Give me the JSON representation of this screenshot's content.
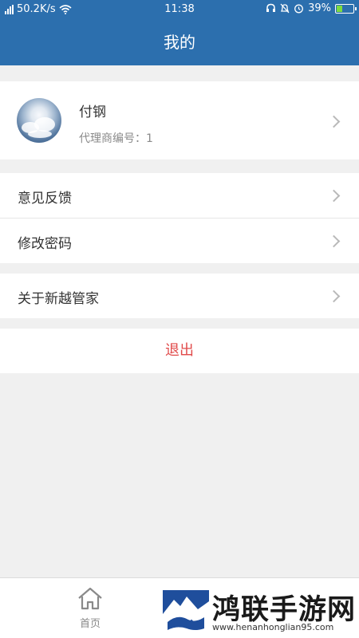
{
  "status_bar": {
    "network_speed": "50.2K/s",
    "time": "11:38",
    "battery": "39%",
    "battery_level": 0.39
  },
  "header": {
    "title": "我的"
  },
  "profile": {
    "name": "付钢",
    "agent_number": "代理商编号：1"
  },
  "menu": {
    "feedback": "意见反馈",
    "change_password": "修改密码",
    "about": "关于新越管家"
  },
  "logout_label": "退出",
  "tabs": {
    "home": "首页"
  },
  "watermark": {
    "text": "鸿联手游网",
    "url": "www.henanhonglian95.com"
  },
  "colors": {
    "header_bg": "#2c6fae",
    "logout_text": "#e14b4b",
    "page_bg": "#f0f0f0"
  }
}
